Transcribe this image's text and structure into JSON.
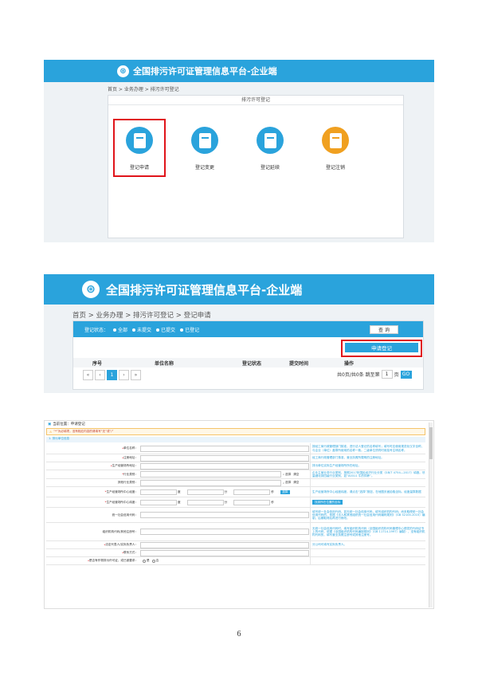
{
  "platform_title": "全国排污许可证管理信息平台-企业端",
  "logo_glyph": "⊛",
  "screen1": {
    "breadcrumb": "首页 > 业务办理 > 排污许可登记",
    "panel_title": "排污许可登记",
    "tiles": [
      {
        "label": "登记申请",
        "icon": "register-apply-icon",
        "color": "#2aa3dc"
      },
      {
        "label": "登记变更",
        "icon": "register-change-icon",
        "color": "#2aa3dc"
      },
      {
        "label": "登记延续",
        "icon": "register-extend-icon",
        "color": "#2aa3dc"
      },
      {
        "label": "登记注销",
        "icon": "register-cancel-icon",
        "color": "#f0a020"
      }
    ]
  },
  "screen2": {
    "breadcrumb": "首页 > 业务办理 > 排污许可登记 > 登记申请",
    "status_label": "登记状态：",
    "status_options": [
      "全部",
      "未提交",
      "已提交",
      "已登记"
    ],
    "query_button": "查 询",
    "apply_button": "申请登记",
    "columns": [
      "序号",
      "单位名称",
      "登记状态",
      "提交时间",
      "操作"
    ],
    "pager_buttons": [
      "«",
      "‹",
      "1",
      "›",
      "»"
    ],
    "pager_info": "共0页/共0条 跳至第",
    "pager_page": "1",
    "pager_unit": "页",
    "go_button": "GO"
  },
  "screen3": {
    "location": "当前位置：申请登记",
    "notice": "“*”为必填项，没有相应内容的请填写“无”或“/”",
    "section": "1. 排污单位信息",
    "rows": [
      {
        "label": "单位名称：",
        "required": true,
        "note": "按经工商行政管理部门核准，进行法人登记的名称填写；填写时应使用规范化汉字全称，与企业（单位）盖章所使用的名称一致。二级单位须同时用括号注明名称。"
      },
      {
        "label": "注册地址：",
        "required": true,
        "note": "经工商行政管理部门核准，营业执照所载明的注册地址。"
      },
      {
        "label": "生产经营场所地址：",
        "required": true,
        "note": "排污单位实际生产经营场所所在地址。"
      },
      {
        "label": "行业类别：",
        "required": true,
        "select": "选择",
        "clear": "清空",
        "note": "企业主营业务行业类别，按照2017年国民经济行业分类（GB/T 4754—2017）填报。尽量细化到四级行业类别，如“A0311 牛的饲养”。"
      },
      {
        "label": "其他行业类别：",
        "required": false,
        "select": "选择",
        "clear": "清空",
        "note": ""
      },
      {
        "label": "生产经营场所中心经度：",
        "required": true,
        "units": [
          "度",
          "分",
          "秒"
        ],
        "pick": "选择",
        "note": "生产经营场所中心经度纬度，请点击“选择”按钮，在地图页面拾取坐标。经度量算数据"
      },
      {
        "label": "生产经营场所中心纬度：",
        "required": true,
        "units": [
          "度",
          "分",
          "秒"
        ],
        "pick_note": "找到所在位置的坐标",
        "note": ""
      },
      {
        "label": "统一社会信用代码：",
        "required": false,
        "note": "填写统一社会信用代码，如无统一社会信用代码，填写组织机构代码；尚未取得统一社会信用代码的，依据《法人和其他组织统一社会信用代码编码规则》（GB 32100-2015）编制，后期取得后再进行修改。"
      },
      {
        "label": "组织机构代码/其他注册号：",
        "required": false,
        "note": "无统一社会信用代码时，填写组织机构代码（全国组织机构代码管理中心颁发的代码证书上的代码，依据《全国组织机构代码编制规则》（GB 11714-1997）编制），没有组织机构代码的，填写营业执照注册号或其他注册号。"
      },
      {
        "label": "法定代表人/实际负责人：",
        "required": true,
        "note": "分公司可填写实际负责人。"
      },
      {
        "label": "联系方式：",
        "required": true,
        "note": ""
      },
      {
        "label": "是否有作物排污许可证，或已被要求：",
        "required": true,
        "radios": [
          "是",
          "否"
        ],
        "note": ""
      }
    ]
  },
  "page_number": "6"
}
